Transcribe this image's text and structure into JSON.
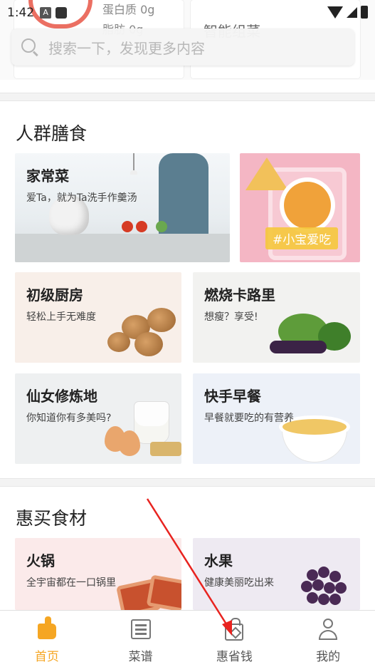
{
  "status_bar": {
    "time": "1:42"
  },
  "background_peek": {
    "left_line1": "蛋白质 0g",
    "left_line2": "脂肪 0g",
    "right_title": "智能组菜"
  },
  "search": {
    "placeholder": "搜索一下，发现更多内容"
  },
  "crowd_section": {
    "title": "人群膳食",
    "cards": [
      {
        "title": "家常菜",
        "subtitle": "爱Ta，就为Ta洗手作羹汤"
      },
      {
        "tag": "#小宝爱吃"
      },
      {
        "title": "初级厨房",
        "subtitle": "轻松上手无难度"
      },
      {
        "title": "燃烧卡路里",
        "subtitle": "想瘦？享受!"
      },
      {
        "title": "仙女修炼地",
        "subtitle": "你知道你有多美吗?"
      },
      {
        "title": "快手早餐",
        "subtitle": "早餐就要吃的有营养"
      }
    ]
  },
  "buy_section": {
    "title": "惠买食材",
    "cards": [
      {
        "title": "火锅",
        "subtitle": "全宇宙都在一口锅里"
      },
      {
        "title": "水果",
        "subtitle": "健康美丽吃出来"
      }
    ]
  },
  "tabbar": {
    "tabs": [
      {
        "label": "首页",
        "icon": "thumbs-up-icon",
        "active": true
      },
      {
        "label": "菜谱",
        "icon": "recipe-book-icon",
        "active": false
      },
      {
        "label": "惠省钱",
        "icon": "shopping-bag-icon",
        "active": false
      },
      {
        "label": "我的",
        "icon": "user-icon",
        "active": false
      }
    ]
  },
  "colors": {
    "accent": "#f5a623",
    "annotation_arrow": "#e8231f"
  }
}
